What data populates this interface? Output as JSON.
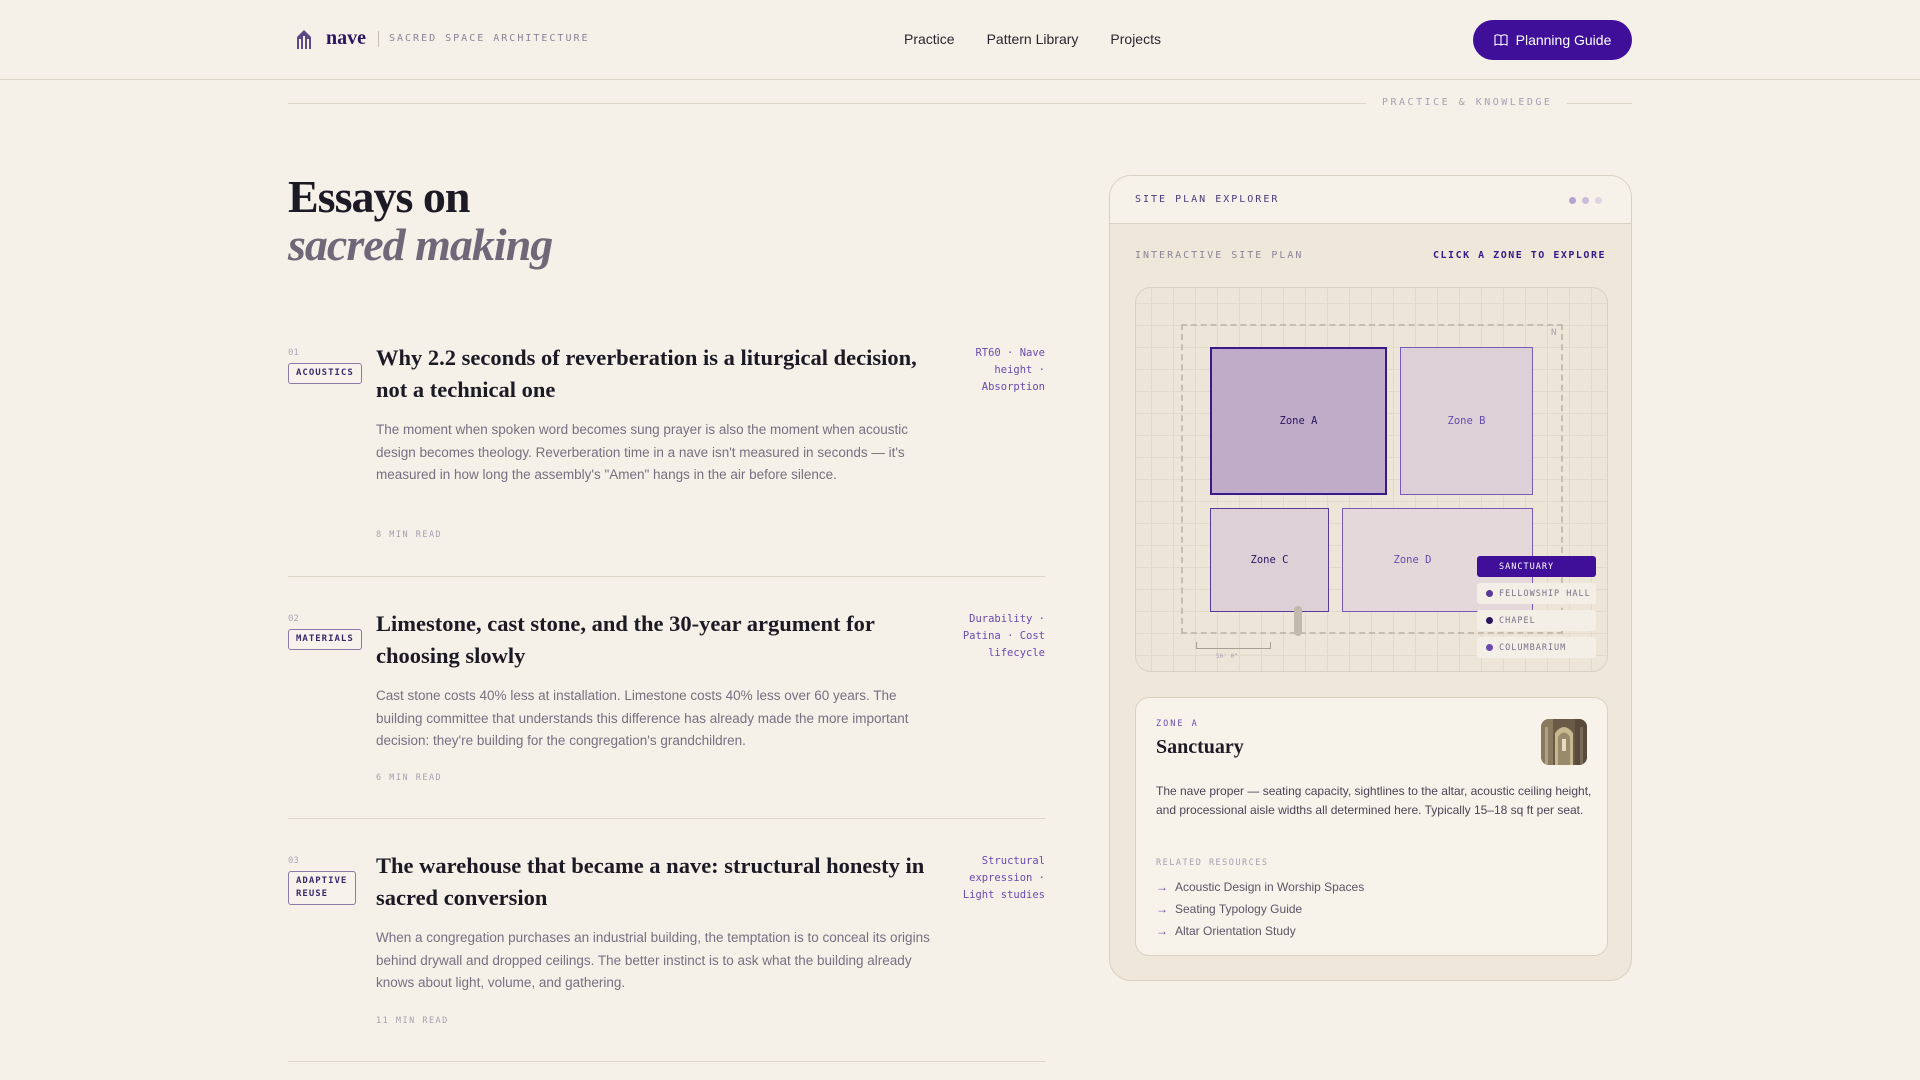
{
  "brand": {
    "name": "nave",
    "tagline": "SACRED SPACE ARCHITECTURE"
  },
  "nav": {
    "items": [
      "Practice",
      "Pattern Library",
      "Projects"
    ]
  },
  "cta": {
    "label": "Planning Guide"
  },
  "section": {
    "label": "PRACTICE & KNOWLEDGE"
  },
  "heading": {
    "line1": "Essays on",
    "line2": "sacred making"
  },
  "essays": [
    {
      "num": "01",
      "tag": "ACOUSTICS",
      "title": "Why 2.2 seconds of reverberation is a liturgical decision, not a technical one",
      "body": "The moment when spoken word becomes sung prayer is also the moment when acoustic design becomes theology. Reverberation time in a nave isn't measured in seconds — it's measured in how long the assembly's \"Amen\" hangs in the air before silence.",
      "read": "8 MIN READ",
      "keys": "RT60 · Nave height · Absorption"
    },
    {
      "num": "02",
      "tag": "MATERIALS",
      "title": "Limestone, cast stone, and the 30-year argument for choosing slowly",
      "body": "Cast stone costs 40% less at installation. Limestone costs 40% less over 60 years. The building committee that understands this difference has already made the more important decision: they're building for the congregation's grandchildren.",
      "read": "6 MIN READ",
      "keys": "Durability · Patina · Cost lifecycle"
    },
    {
      "num": "03",
      "tag": "ADAPTIVE REUSE",
      "title": "The warehouse that became a nave: structural honesty in sacred conversion",
      "body": "When a congregation purchases an industrial building, the temptation is to conceal its origins behind drywall and dropped ceilings. The better instinct is to ask what the building already knows about light, volume, and gathering.",
      "read": "11 MIN READ",
      "keys": "Structural expression · Light studies"
    }
  ],
  "explorer": {
    "title": "SITE PLAN EXPLORER",
    "subtitle": "INTERACTIVE SITE PLAN",
    "hint": "CLICK A ZONE TO EXPLORE",
    "north": "N",
    "scale_label": "50' 0\"",
    "zones": [
      "Zone A",
      "Zone B",
      "Zone C",
      "Zone D"
    ],
    "legend": [
      {
        "label": "SANCTUARY",
        "active": true
      },
      {
        "label": "FELLOWSHIP HALL",
        "active": false
      },
      {
        "label": "CHAPEL",
        "active": false
      },
      {
        "label": "COLUMBARIUM",
        "active": false
      }
    ],
    "detail": {
      "kicker": "ZONE A",
      "title": "Sanctuary",
      "body": "The nave proper — seating capacity, sightlines to the altar, acoustic ceiling height, and processional aisle widths all determined here. Typically 15–18 sq ft per seat.",
      "related_label": "RELATED RESOURCES",
      "links": [
        "Acoustic Design in Worship Spaces",
        "Seating Typology Guide",
        "Altar Orientation Study"
      ]
    }
  },
  "colors": {
    "accent": "#3f0f9a",
    "background": "#f5f0e8",
    "muted": "#6a4ab0"
  }
}
